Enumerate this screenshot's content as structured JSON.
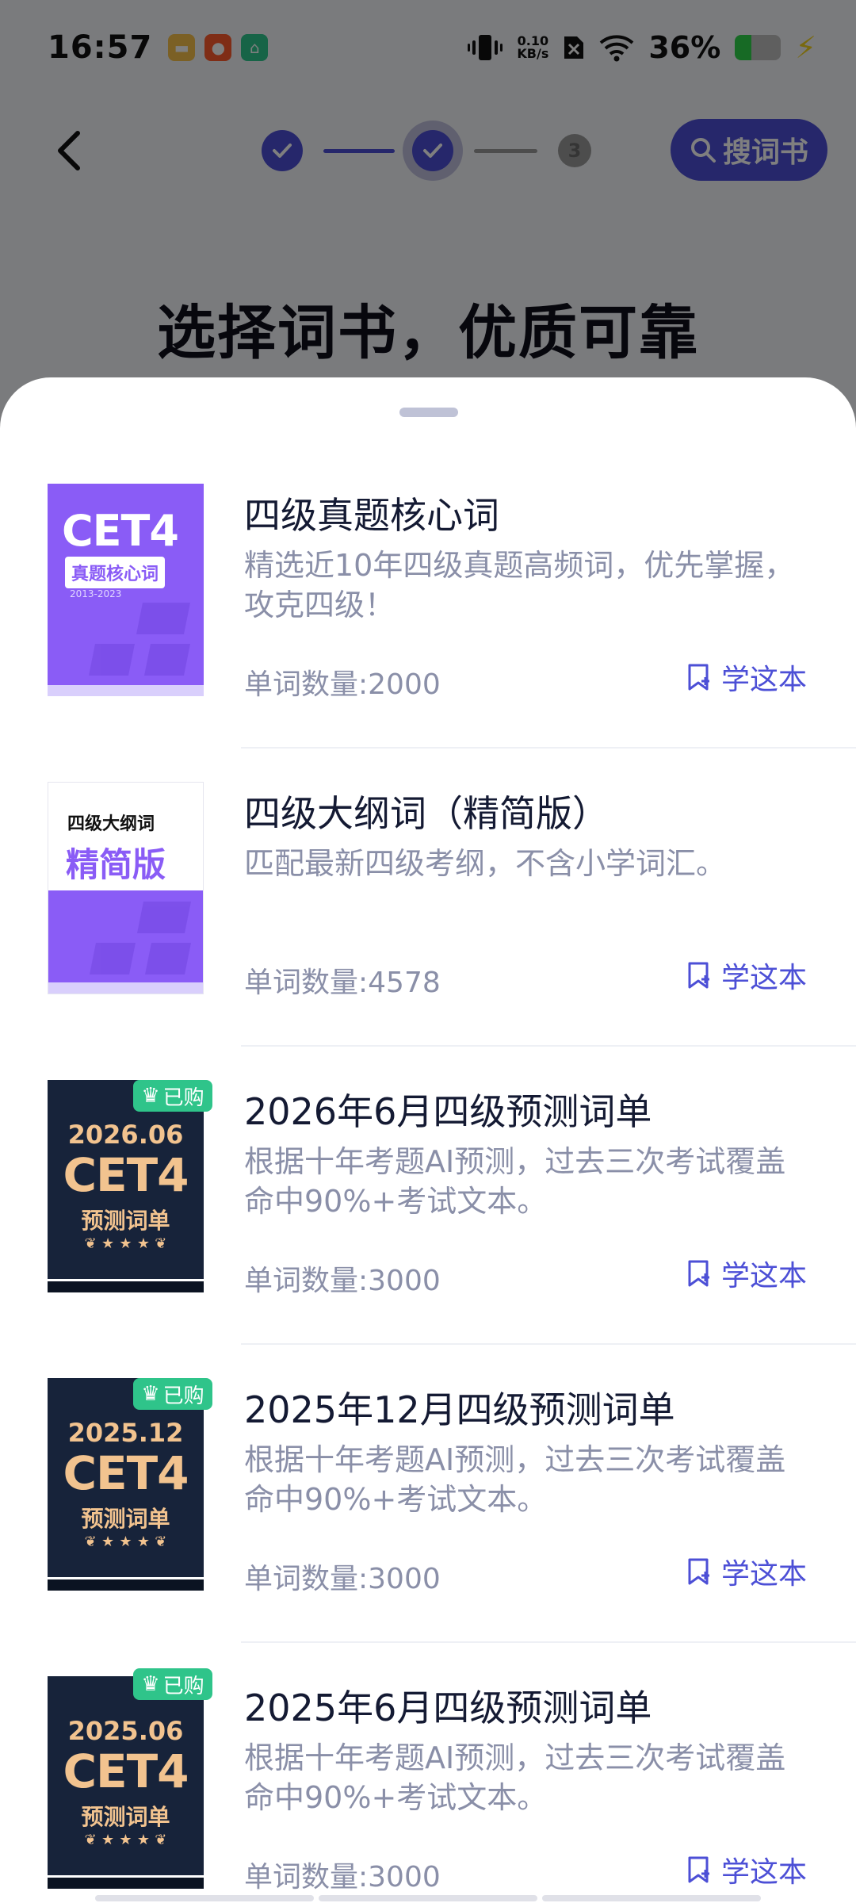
{
  "status": {
    "time": "16:57",
    "net_speed_value": "0.10",
    "net_speed_unit": "KB/s",
    "battery_pct": "36%",
    "battery_level": 0.36
  },
  "nav": {
    "steps": [
      {
        "state": "done"
      },
      {
        "state": "current"
      },
      {
        "state": "todo",
        "label": "3"
      }
    ],
    "search_label": "搜词书"
  },
  "page_title": "选择词书，优质可靠",
  "books": [
    {
      "title": "四级真题核心词",
      "desc": "精选近10年四级真题高频词，优先掌握，攻克四级！",
      "count": "单词数量:2000",
      "action": "学这本",
      "cover": {
        "style": "purple",
        "line1": "CET4",
        "line2": "真题核心词",
        "line3": "2013-2023"
      }
    },
    {
      "title": "四级大纲词（精简版）",
      "desc": "匹配最新四级考纲，不含小学词汇。",
      "count": "单词数量:4578",
      "action": "学这本",
      "cover": {
        "style": "white",
        "line1": "四级大纲词",
        "line2": "精简版"
      }
    },
    {
      "title": "2026年6月四级预测词单",
      "desc": "根据十年考题AI预测，过去三次考试覆盖命中90%+考试文本。",
      "count": "单词数量:3000",
      "action": "学这本",
      "badge": "已购",
      "cover": {
        "style": "dark",
        "line1": "2026.06",
        "line2": "CET4",
        "line3": "预测词单"
      }
    },
    {
      "title": "2025年12月四级预测词单",
      "desc": "根据十年考题AI预测，过去三次考试覆盖命中90%+考试文本。",
      "count": "单词数量:3000",
      "action": "学这本",
      "badge": "已购",
      "cover": {
        "style": "dark",
        "line1": "2025.12",
        "line2": "CET4",
        "line3": "预测词单"
      }
    },
    {
      "title": "2025年6月四级预测词单",
      "desc": "根据十年考题AI预测，过去三次考试覆盖命中90%+考试文本。",
      "count": "单词数量:3000",
      "action": "学这本",
      "badge": "已购",
      "cover": {
        "style": "dark",
        "line1": "2025.06",
        "line2": "CET4",
        "line3": "预测词单"
      }
    }
  ],
  "colors": {
    "accent": "#4c4fd6",
    "badge_green": "#2fc48a",
    "cover_purple": "#8a5cf6",
    "cover_dark": "#17233a",
    "cover_gold": "#f2c38f"
  }
}
